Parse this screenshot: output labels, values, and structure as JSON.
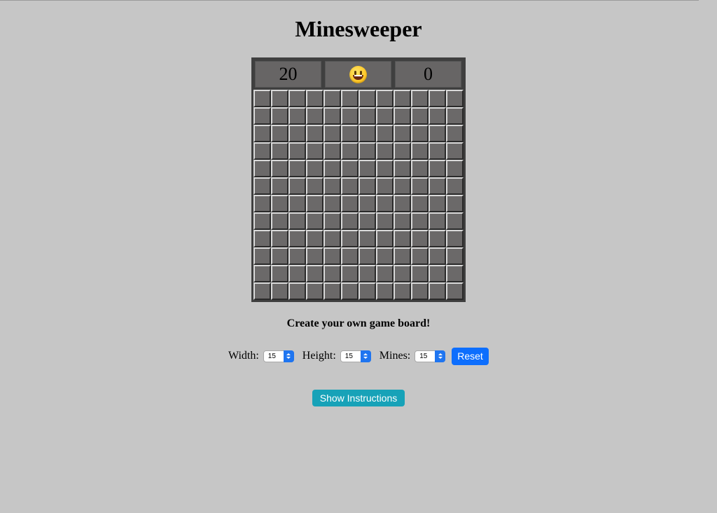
{
  "page": {
    "title": "Minesweeper"
  },
  "board": {
    "mines_remaining": "20",
    "face_icon": "smiley-face-icon",
    "timer": "0",
    "rows": 12,
    "cols": 12,
    "cell_state": "covered"
  },
  "settings": {
    "heading": "Create your own game board!",
    "width_label": "Width:",
    "width_value": "15",
    "height_label": "Height:",
    "height_value": "15",
    "mines_label": "Mines:",
    "mines_value": "15",
    "reset_label": "Reset"
  },
  "instructions": {
    "button_label": "Show Instructions"
  },
  "colors": {
    "background": "#c6c6c6",
    "board_frame": "#3f3f3f",
    "cell": "#6b6969",
    "reset_button": "#0d6efd",
    "instructions_button": "#17a2b8"
  }
}
